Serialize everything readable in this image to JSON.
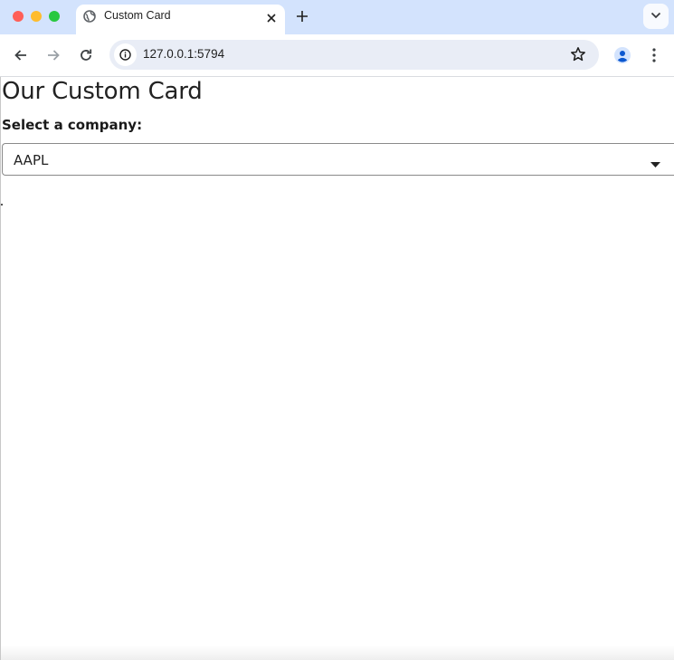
{
  "browser": {
    "tab": {
      "title": "Custom Card"
    },
    "address_bar": {
      "url": "127.0.0.1:5794"
    }
  },
  "page": {
    "title": "Our Custom Card",
    "select_label": "Select a company:",
    "select": {
      "selected_value": "AAPL"
    }
  },
  "icons": [
    "globe-icon",
    "close-icon",
    "plus-icon",
    "chevron-down-icon",
    "back-arrow-icon",
    "forward-arrow-icon",
    "reload-icon",
    "info-icon",
    "star-icon",
    "profile-icon",
    "kebab-menu-icon",
    "caret-down-icon"
  ],
  "colors": {
    "tabstrip_bg": "#d3e3fd",
    "omnibox_bg": "#e9edf6",
    "traffic_close": "#ff5f57",
    "traffic_min": "#febc2e",
    "traffic_max": "#28c840",
    "profile_blue": "#0b57d0"
  }
}
